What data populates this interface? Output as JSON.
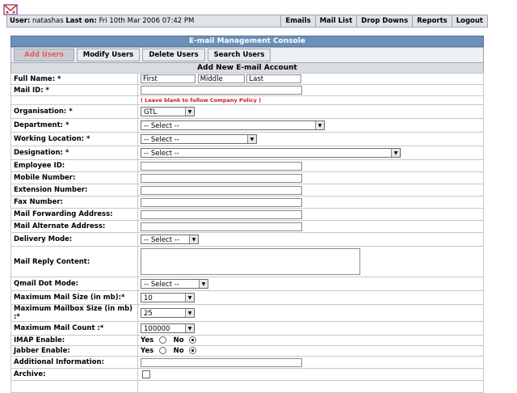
{
  "header": {
    "user_label": "User:",
    "user_name": "natashas",
    "last_on_label": "Last on:",
    "last_on_value": "Fri 10th Mar 2006 07:42 PM",
    "nav": [
      "Emails",
      "Mail List",
      "Drop Downs",
      "Reports",
      "Logout"
    ]
  },
  "console": {
    "title": "E-mail Management Console"
  },
  "tabs": [
    "Add Users",
    "Modify Users",
    "Delete Users",
    "Search Users"
  ],
  "section_title": "Add New E-mail Account",
  "form": {
    "full_name": {
      "label": "Full Name: *",
      "first": "First",
      "middle": "Middle",
      "last": "Last"
    },
    "mail_id": {
      "label": "Mail ID: *",
      "value": "",
      "hint": "( Leave blank to follow Company Policy )"
    },
    "organisation": {
      "label": "Organisation: *",
      "value": "GTL"
    },
    "department": {
      "label": "Department: *",
      "value": "-- Select --"
    },
    "working_location": {
      "label": "Working Location: *",
      "value": "-- Select --"
    },
    "designation": {
      "label": "Designation: *",
      "value": "-- Select --"
    },
    "employee_id": {
      "label": "Employee ID:",
      "value": ""
    },
    "mobile_number": {
      "label": "Mobile Number:",
      "value": ""
    },
    "extension_number": {
      "label": "Extension Number:",
      "value": ""
    },
    "fax_number": {
      "label": "Fax Number:",
      "value": ""
    },
    "mail_forwarding": {
      "label": "Mail Forwarding Address:",
      "value": ""
    },
    "mail_alternate": {
      "label": "Mail Alternate Address:",
      "value": ""
    },
    "delivery_mode": {
      "label": "Delivery Mode:",
      "value": "-- Select --"
    },
    "mail_reply": {
      "label": "Mail Reply Content:",
      "value": ""
    },
    "qmail_dot": {
      "label": "Qmail Dot Mode:",
      "value": "-- Select --"
    },
    "max_mail_size": {
      "label": "Maximum Mail Size (in mb):*",
      "value": "10"
    },
    "max_mailbox_size": {
      "label": "Maximum Mailbox Size (in mb) :*",
      "value": "25"
    },
    "max_mail_count": {
      "label": "Maximum Mail Count :*",
      "value": "100000"
    },
    "imap": {
      "label": "IMAP Enable:",
      "yes": "Yes",
      "no": "No",
      "selected": "No"
    },
    "jabber": {
      "label": "Jabber Enable:",
      "yes": "Yes",
      "no": "No",
      "selected": "No"
    },
    "additional_info": {
      "label": "Additional Information:",
      "value": ""
    },
    "archive": {
      "label": "Archive:",
      "checked": false
    }
  }
}
